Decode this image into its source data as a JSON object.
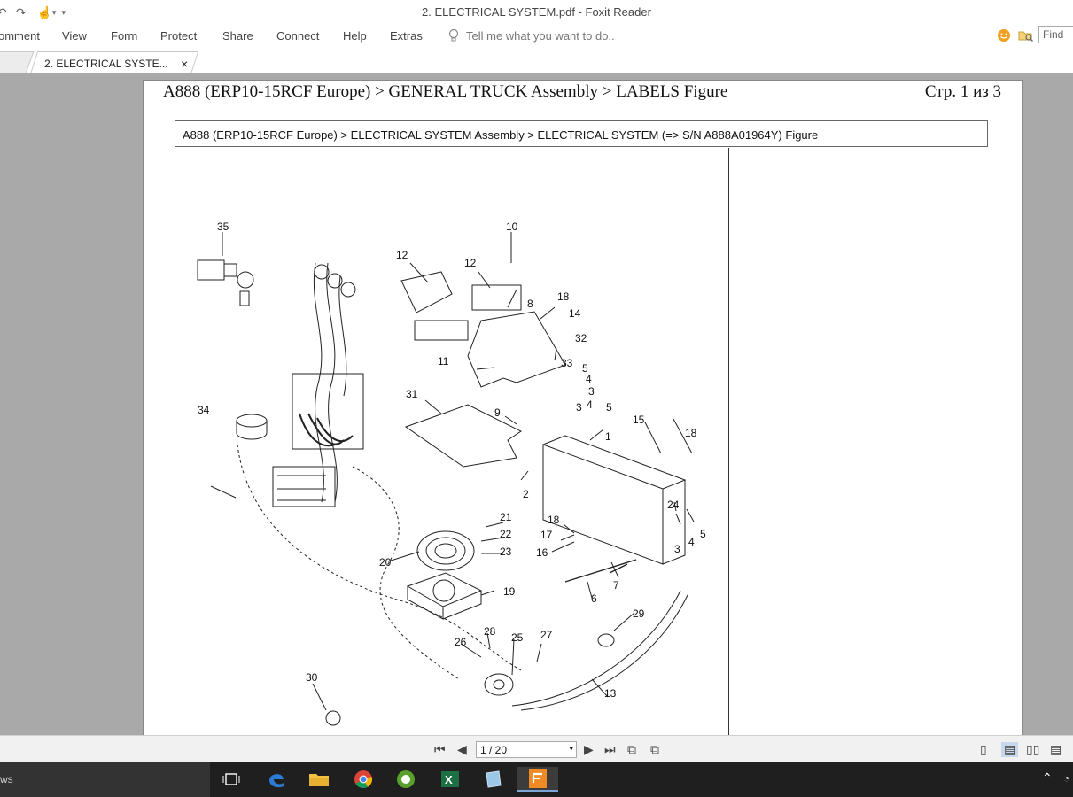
{
  "window": {
    "title": "2. ELECTRICAL SYSTEM.pdf - Foxit Reader"
  },
  "menu": [
    "omment",
    "View",
    "Form",
    "Protect",
    "Share",
    "Connect",
    "Help",
    "Extras"
  ],
  "tell_me": {
    "placeholder": "Tell me what you want to do.."
  },
  "find": {
    "placeholder": "Find"
  },
  "tab": {
    "label": "2. ELECTRICAL SYSTE...",
    "close": "×"
  },
  "page": {
    "header_left": "A888 (ERP10-15RCF Europe) > GENERAL TRUCK Assembly > LABELS Figure",
    "header_right": "Стр. 1 из 3",
    "subheader": "A888 (ERP10-15RCF Europe) > ELECTRICAL SYSTEM Assembly > ELECTRICAL SYSTEM (=> S/N A888A01964Y) Figure"
  },
  "figure": {
    "callouts": [
      "35",
      "10",
      "12",
      "12",
      "8",
      "18",
      "14",
      "32",
      "11",
      "33",
      "5",
      "4",
      "3",
      "3",
      "4",
      "5",
      "31",
      "9",
      "1",
      "15",
      "18",
      "2",
      "24",
      "5",
      "4",
      "3",
      "21",
      "22",
      "23",
      "18",
      "17",
      "16",
      "20",
      "19",
      "7",
      "6",
      "29",
      "28",
      "25",
      "27",
      "26",
      "13",
      "30",
      "34"
    ]
  },
  "statusbar": {
    "page_indicator": "1 / 20"
  },
  "taskbar": {
    "search_text": "ws"
  },
  "colors": {
    "viewer_bg": "#a9a9a9",
    "taskbar_bg": "#1f1f1f",
    "accent": "#f0a020"
  }
}
